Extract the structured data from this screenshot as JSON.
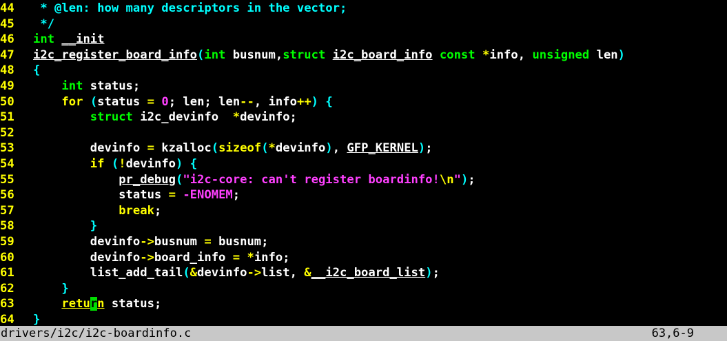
{
  "colors": {
    "background": "#000000",
    "line_number": "#ffff00",
    "normal": "#ffffff",
    "comment": "#00ffff",
    "type": "#00ff00",
    "keyword": "#ffff00",
    "operator": "#ffff00",
    "number": "#ff40ff",
    "string": "#ff40ff",
    "punct": "#00ffff",
    "cursor_bg": "#00dd00",
    "statusbar_bg": "#c8c8c8"
  },
  "lines": [
    {
      "num": "44",
      "tokens": [
        {
          "t": " * @len: how many descriptors in the vector;",
          "c": "comment"
        }
      ]
    },
    {
      "num": "45",
      "tokens": [
        {
          "t": " */",
          "c": "comment"
        }
      ]
    },
    {
      "num": "46",
      "tokens": [
        {
          "t": "int",
          "c": "type"
        },
        {
          "t": " ",
          "c": "normal"
        },
        {
          "t": "__init",
          "c": "normal",
          "u": true
        }
      ]
    },
    {
      "num": "47",
      "tokens": [
        {
          "t": "i2c_register_board_info",
          "c": "normal",
          "u": true
        },
        {
          "t": "(",
          "c": "punct"
        },
        {
          "t": "int",
          "c": "type"
        },
        {
          "t": " busnum,",
          "c": "normal"
        },
        {
          "t": "struct",
          "c": "type"
        },
        {
          "t": " ",
          "c": "normal"
        },
        {
          "t": "i2c_board_info",
          "c": "normal",
          "u": true
        },
        {
          "t": " ",
          "c": "normal"
        },
        {
          "t": "const",
          "c": "type"
        },
        {
          "t": " ",
          "c": "normal"
        },
        {
          "t": "*",
          "c": "operator"
        },
        {
          "t": "info, ",
          "c": "normal"
        },
        {
          "t": "unsigned",
          "c": "type"
        },
        {
          "t": " len",
          "c": "normal"
        },
        {
          "t": ")",
          "c": "punct"
        }
      ]
    },
    {
      "num": "48",
      "tokens": [
        {
          "t": "{",
          "c": "punct"
        }
      ]
    },
    {
      "num": "49",
      "tokens": [
        {
          "t": "    ",
          "c": "normal"
        },
        {
          "t": "int",
          "c": "type"
        },
        {
          "t": " status;",
          "c": "normal"
        }
      ]
    },
    {
      "num": "50",
      "tokens": [
        {
          "t": "    ",
          "c": "normal"
        },
        {
          "t": "for",
          "c": "keyword"
        },
        {
          "t": " ",
          "c": "normal"
        },
        {
          "t": "(",
          "c": "punct"
        },
        {
          "t": "status ",
          "c": "normal"
        },
        {
          "t": "=",
          "c": "operator"
        },
        {
          "t": " ",
          "c": "normal"
        },
        {
          "t": "0",
          "c": "number"
        },
        {
          "t": "; len; len",
          "c": "normal"
        },
        {
          "t": "--",
          "c": "operator"
        },
        {
          "t": ", info",
          "c": "normal"
        },
        {
          "t": "++",
          "c": "operator"
        },
        {
          "t": ")",
          "c": "punct"
        },
        {
          "t": " ",
          "c": "normal"
        },
        {
          "t": "{",
          "c": "punct"
        }
      ]
    },
    {
      "num": "51",
      "tokens": [
        {
          "t": "        ",
          "c": "normal"
        },
        {
          "t": "struct",
          "c": "type"
        },
        {
          "t": " i2c_devinfo  ",
          "c": "normal"
        },
        {
          "t": "*",
          "c": "operator"
        },
        {
          "t": "devinfo;",
          "c": "normal"
        }
      ]
    },
    {
      "num": "52",
      "tokens": []
    },
    {
      "num": "53",
      "tokens": [
        {
          "t": "        devinfo ",
          "c": "normal"
        },
        {
          "t": "=",
          "c": "operator"
        },
        {
          "t": " kzalloc",
          "c": "normal"
        },
        {
          "t": "(",
          "c": "punct"
        },
        {
          "t": "sizeof",
          "c": "keyword"
        },
        {
          "t": "(",
          "c": "punct"
        },
        {
          "t": "*",
          "c": "operator"
        },
        {
          "t": "devinfo",
          "c": "normal"
        },
        {
          "t": ")",
          "c": "punct"
        },
        {
          "t": ", ",
          "c": "normal"
        },
        {
          "t": "GFP_KERNEL",
          "c": "normal",
          "u": true
        },
        {
          "t": ")",
          "c": "punct"
        },
        {
          "t": ";",
          "c": "normal"
        }
      ]
    },
    {
      "num": "54",
      "tokens": [
        {
          "t": "        ",
          "c": "normal"
        },
        {
          "t": "if",
          "c": "keyword"
        },
        {
          "t": " ",
          "c": "normal"
        },
        {
          "t": "(",
          "c": "punct"
        },
        {
          "t": "!",
          "c": "operator"
        },
        {
          "t": "devinfo",
          "c": "normal"
        },
        {
          "t": ")",
          "c": "punct"
        },
        {
          "t": " ",
          "c": "normal"
        },
        {
          "t": "{",
          "c": "punct"
        }
      ]
    },
    {
      "num": "55",
      "tokens": [
        {
          "t": "            ",
          "c": "normal"
        },
        {
          "t": "pr_debug",
          "c": "normal",
          "u": true
        },
        {
          "t": "(",
          "c": "punct"
        },
        {
          "t": "\"i2c-core: can't register boardinfo!",
          "c": "string"
        },
        {
          "t": "\\n",
          "c": "operator"
        },
        {
          "t": "\"",
          "c": "string"
        },
        {
          "t": ")",
          "c": "punct"
        },
        {
          "t": ";",
          "c": "normal"
        }
      ]
    },
    {
      "num": "56",
      "tokens": [
        {
          "t": "            status ",
          "c": "normal"
        },
        {
          "t": "=",
          "c": "operator"
        },
        {
          "t": " ",
          "c": "normal"
        },
        {
          "t": "-ENOMEM",
          "c": "number"
        },
        {
          "t": ";",
          "c": "normal"
        }
      ]
    },
    {
      "num": "57",
      "tokens": [
        {
          "t": "            ",
          "c": "normal"
        },
        {
          "t": "break",
          "c": "keyword"
        },
        {
          "t": ";",
          "c": "normal"
        }
      ]
    },
    {
      "num": "58",
      "tokens": [
        {
          "t": "        ",
          "c": "normal"
        },
        {
          "t": "}",
          "c": "punct"
        }
      ]
    },
    {
      "num": "59",
      "tokens": [
        {
          "t": "        devinfo",
          "c": "normal"
        },
        {
          "t": "->",
          "c": "operator"
        },
        {
          "t": "busnum ",
          "c": "normal"
        },
        {
          "t": "=",
          "c": "operator"
        },
        {
          "t": " busnum;",
          "c": "normal"
        }
      ]
    },
    {
      "num": "60",
      "tokens": [
        {
          "t": "        devinfo",
          "c": "normal"
        },
        {
          "t": "->",
          "c": "operator"
        },
        {
          "t": "board_info ",
          "c": "normal"
        },
        {
          "t": "=",
          "c": "operator"
        },
        {
          "t": " ",
          "c": "normal"
        },
        {
          "t": "*",
          "c": "operator"
        },
        {
          "t": "info;",
          "c": "normal"
        }
      ]
    },
    {
      "num": "61",
      "tokens": [
        {
          "t": "        list_add_tail",
          "c": "normal"
        },
        {
          "t": "(",
          "c": "punct"
        },
        {
          "t": "&",
          "c": "operator"
        },
        {
          "t": "devinfo",
          "c": "normal"
        },
        {
          "t": "->",
          "c": "operator"
        },
        {
          "t": "list, ",
          "c": "normal"
        },
        {
          "t": "&",
          "c": "operator"
        },
        {
          "t": "__i2c_board_list",
          "c": "normal",
          "u": true
        },
        {
          "t": ")",
          "c": "punct"
        },
        {
          "t": ";",
          "c": "normal"
        }
      ]
    },
    {
      "num": "62",
      "tokens": [
        {
          "t": "    ",
          "c": "normal"
        },
        {
          "t": "}",
          "c": "punct"
        }
      ]
    },
    {
      "num": "63",
      "tokens": [
        {
          "t": "    ",
          "c": "normal"
        },
        {
          "t": "retu",
          "c": "keyword",
          "u": true
        },
        {
          "t": "r",
          "c": "cursor"
        },
        {
          "t": "n",
          "c": "keyword",
          "u": true
        },
        {
          "t": " status;",
          "c": "normal"
        }
      ]
    },
    {
      "num": "64",
      "tokens": [
        {
          "t": "}",
          "c": "punct"
        }
      ]
    }
  ],
  "statusbar": {
    "filename": "drivers/i2c/i2c-boardinfo.c",
    "position": "63,6-9"
  }
}
